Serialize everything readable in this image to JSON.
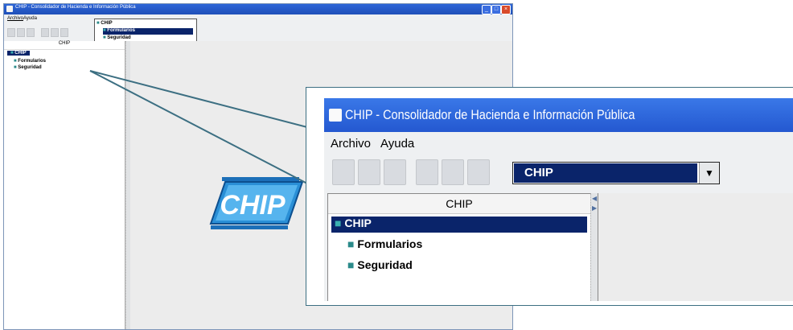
{
  "app": {
    "title": "CHIP - Consolidador de Hacienda e Información Pública",
    "menu": [
      "Archivo",
      "Ayuda"
    ]
  },
  "combo": {
    "value": "CHIP"
  },
  "dropdown": {
    "items": [
      "CHIP",
      "Formularios",
      "Seguridad"
    ],
    "selected": "Formularios"
  },
  "tree": {
    "header": "CHIP",
    "root": "CHIP",
    "children": [
      "Formularios",
      "Seguridad"
    ]
  },
  "logo": {
    "text": "CHIP"
  },
  "colors": {
    "title_bar": "#2458d0",
    "selection": "#0a246a",
    "arrow": "#2e5f6e",
    "callout": "#3c6f82"
  },
  "icons": [
    "java-icon",
    "new-icon",
    "save-icon",
    "print-icon",
    "undo-icon",
    "edit-icon",
    "delete-icon",
    "cube-node-icon"
  ]
}
